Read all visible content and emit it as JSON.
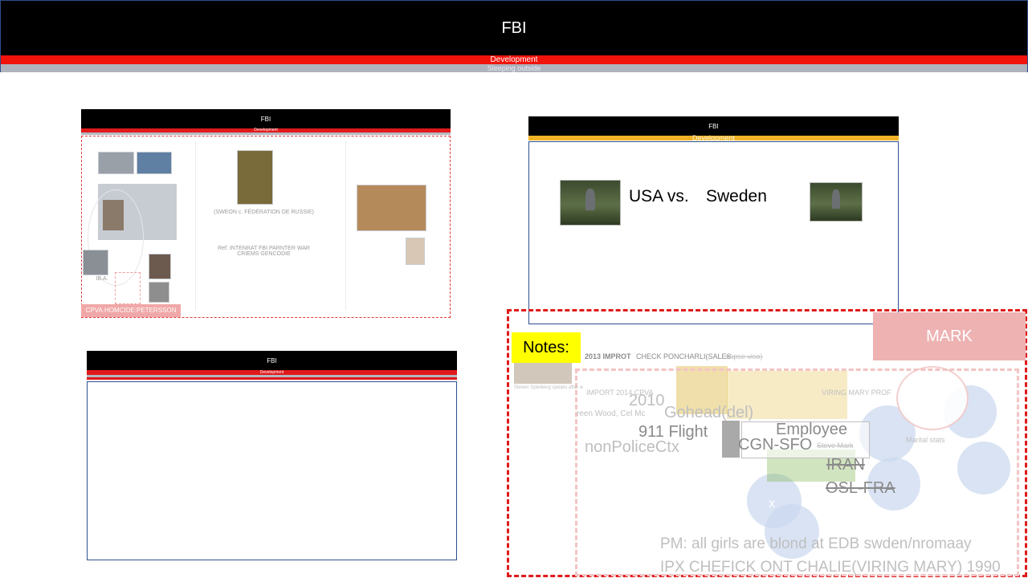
{
  "banner": {
    "title": "FBI",
    "subtitle": "Development",
    "subtitle2": "Sleeping outside"
  },
  "slide_a": {
    "title": "FBI",
    "bar_label": "Development",
    "caption_center": "(SWEON c. FÉDÉRATION DE RUSSIE)",
    "ref_text": "Ref: INTENRAT FBI PARNTER WAR CRIEMS GENCODIE",
    "iba_text": "IB.A.",
    "tag": "CPVA.HOMCIDE:PETERSSON"
  },
  "slide_b": {
    "title": "FBI",
    "bar_label": "Development"
  },
  "slide_c": {
    "title": "FBI",
    "bar_label": "Development",
    "usa_text": "USA  vs.",
    "sweden_text": "Sweden"
  },
  "notes": {
    "label": "Notes:",
    "mark": "MARK",
    "line_2013_a": "2013 IMPROT",
    "line_2013_b": "CHECK PONCHARLI(SALES",
    "line_2013_c": "sapse viso)",
    "import_2014": "IMPORT 2014 CPVA",
    "import_tail": "VIRING MARY PROF",
    "year_2010": "2010",
    "flight": "911 Flight",
    "gohead": "Gohead(del)",
    "nonpolice": "nonPoliceCtx",
    "cgn_sfo": "CGN-SFO",
    "employee": "Employee",
    "steve_mark": "Steve Mark",
    "iran": "IRAN",
    "osl_fra": "OSL-FRA",
    "x_mark": "x",
    "pm_line": "PM: all girls are blond at EDB swden/nromaay",
    "ipx_line": "IPX CHEFICK ONT CHALIE(VIRING MARY) 1990",
    "small_left_a": "reen Wood, Cel Mc",
    "small_left_b": "Steven Spielberg speaks after w",
    "martial": "Marital stats"
  }
}
